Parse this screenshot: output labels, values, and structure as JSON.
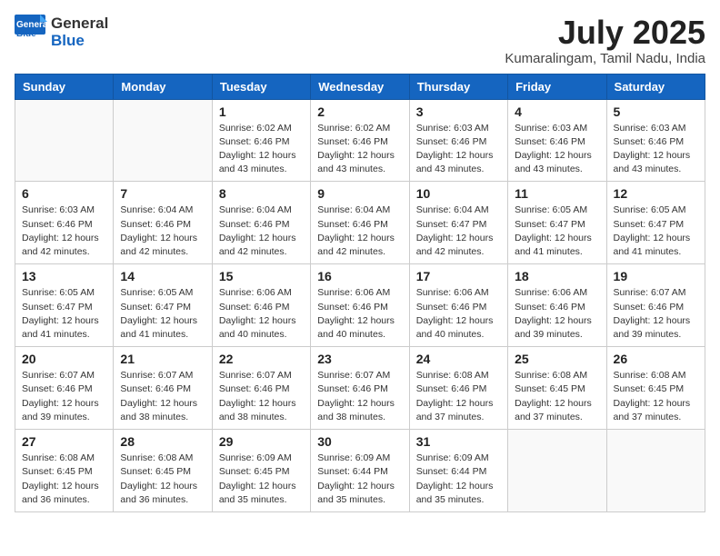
{
  "header": {
    "logo_general": "General",
    "logo_blue": "Blue",
    "title": "July 2025",
    "location": "Kumaralingam, Tamil Nadu, India"
  },
  "calendar": {
    "weekdays": [
      "Sunday",
      "Monday",
      "Tuesday",
      "Wednesday",
      "Thursday",
      "Friday",
      "Saturday"
    ],
    "weeks": [
      [
        {
          "day": "",
          "info": ""
        },
        {
          "day": "",
          "info": ""
        },
        {
          "day": "1",
          "info": "Sunrise: 6:02 AM\nSunset: 6:46 PM\nDaylight: 12 hours and 43 minutes."
        },
        {
          "day": "2",
          "info": "Sunrise: 6:02 AM\nSunset: 6:46 PM\nDaylight: 12 hours and 43 minutes."
        },
        {
          "day": "3",
          "info": "Sunrise: 6:03 AM\nSunset: 6:46 PM\nDaylight: 12 hours and 43 minutes."
        },
        {
          "day": "4",
          "info": "Sunrise: 6:03 AM\nSunset: 6:46 PM\nDaylight: 12 hours and 43 minutes."
        },
        {
          "day": "5",
          "info": "Sunrise: 6:03 AM\nSunset: 6:46 PM\nDaylight: 12 hours and 43 minutes."
        }
      ],
      [
        {
          "day": "6",
          "info": "Sunrise: 6:03 AM\nSunset: 6:46 PM\nDaylight: 12 hours and 42 minutes."
        },
        {
          "day": "7",
          "info": "Sunrise: 6:04 AM\nSunset: 6:46 PM\nDaylight: 12 hours and 42 minutes."
        },
        {
          "day": "8",
          "info": "Sunrise: 6:04 AM\nSunset: 6:46 PM\nDaylight: 12 hours and 42 minutes."
        },
        {
          "day": "9",
          "info": "Sunrise: 6:04 AM\nSunset: 6:46 PM\nDaylight: 12 hours and 42 minutes."
        },
        {
          "day": "10",
          "info": "Sunrise: 6:04 AM\nSunset: 6:47 PM\nDaylight: 12 hours and 42 minutes."
        },
        {
          "day": "11",
          "info": "Sunrise: 6:05 AM\nSunset: 6:47 PM\nDaylight: 12 hours and 41 minutes."
        },
        {
          "day": "12",
          "info": "Sunrise: 6:05 AM\nSunset: 6:47 PM\nDaylight: 12 hours and 41 minutes."
        }
      ],
      [
        {
          "day": "13",
          "info": "Sunrise: 6:05 AM\nSunset: 6:47 PM\nDaylight: 12 hours and 41 minutes."
        },
        {
          "day": "14",
          "info": "Sunrise: 6:05 AM\nSunset: 6:47 PM\nDaylight: 12 hours and 41 minutes."
        },
        {
          "day": "15",
          "info": "Sunrise: 6:06 AM\nSunset: 6:46 PM\nDaylight: 12 hours and 40 minutes."
        },
        {
          "day": "16",
          "info": "Sunrise: 6:06 AM\nSunset: 6:46 PM\nDaylight: 12 hours and 40 minutes."
        },
        {
          "day": "17",
          "info": "Sunrise: 6:06 AM\nSunset: 6:46 PM\nDaylight: 12 hours and 40 minutes."
        },
        {
          "day": "18",
          "info": "Sunrise: 6:06 AM\nSunset: 6:46 PM\nDaylight: 12 hours and 39 minutes."
        },
        {
          "day": "19",
          "info": "Sunrise: 6:07 AM\nSunset: 6:46 PM\nDaylight: 12 hours and 39 minutes."
        }
      ],
      [
        {
          "day": "20",
          "info": "Sunrise: 6:07 AM\nSunset: 6:46 PM\nDaylight: 12 hours and 39 minutes."
        },
        {
          "day": "21",
          "info": "Sunrise: 6:07 AM\nSunset: 6:46 PM\nDaylight: 12 hours and 38 minutes."
        },
        {
          "day": "22",
          "info": "Sunrise: 6:07 AM\nSunset: 6:46 PM\nDaylight: 12 hours and 38 minutes."
        },
        {
          "day": "23",
          "info": "Sunrise: 6:07 AM\nSunset: 6:46 PM\nDaylight: 12 hours and 38 minutes."
        },
        {
          "day": "24",
          "info": "Sunrise: 6:08 AM\nSunset: 6:46 PM\nDaylight: 12 hours and 37 minutes."
        },
        {
          "day": "25",
          "info": "Sunrise: 6:08 AM\nSunset: 6:45 PM\nDaylight: 12 hours and 37 minutes."
        },
        {
          "day": "26",
          "info": "Sunrise: 6:08 AM\nSunset: 6:45 PM\nDaylight: 12 hours and 37 minutes."
        }
      ],
      [
        {
          "day": "27",
          "info": "Sunrise: 6:08 AM\nSunset: 6:45 PM\nDaylight: 12 hours and 36 minutes."
        },
        {
          "day": "28",
          "info": "Sunrise: 6:08 AM\nSunset: 6:45 PM\nDaylight: 12 hours and 36 minutes."
        },
        {
          "day": "29",
          "info": "Sunrise: 6:09 AM\nSunset: 6:45 PM\nDaylight: 12 hours and 35 minutes."
        },
        {
          "day": "30",
          "info": "Sunrise: 6:09 AM\nSunset: 6:44 PM\nDaylight: 12 hours and 35 minutes."
        },
        {
          "day": "31",
          "info": "Sunrise: 6:09 AM\nSunset: 6:44 PM\nDaylight: 12 hours and 35 minutes."
        },
        {
          "day": "",
          "info": ""
        },
        {
          "day": "",
          "info": ""
        }
      ]
    ]
  }
}
